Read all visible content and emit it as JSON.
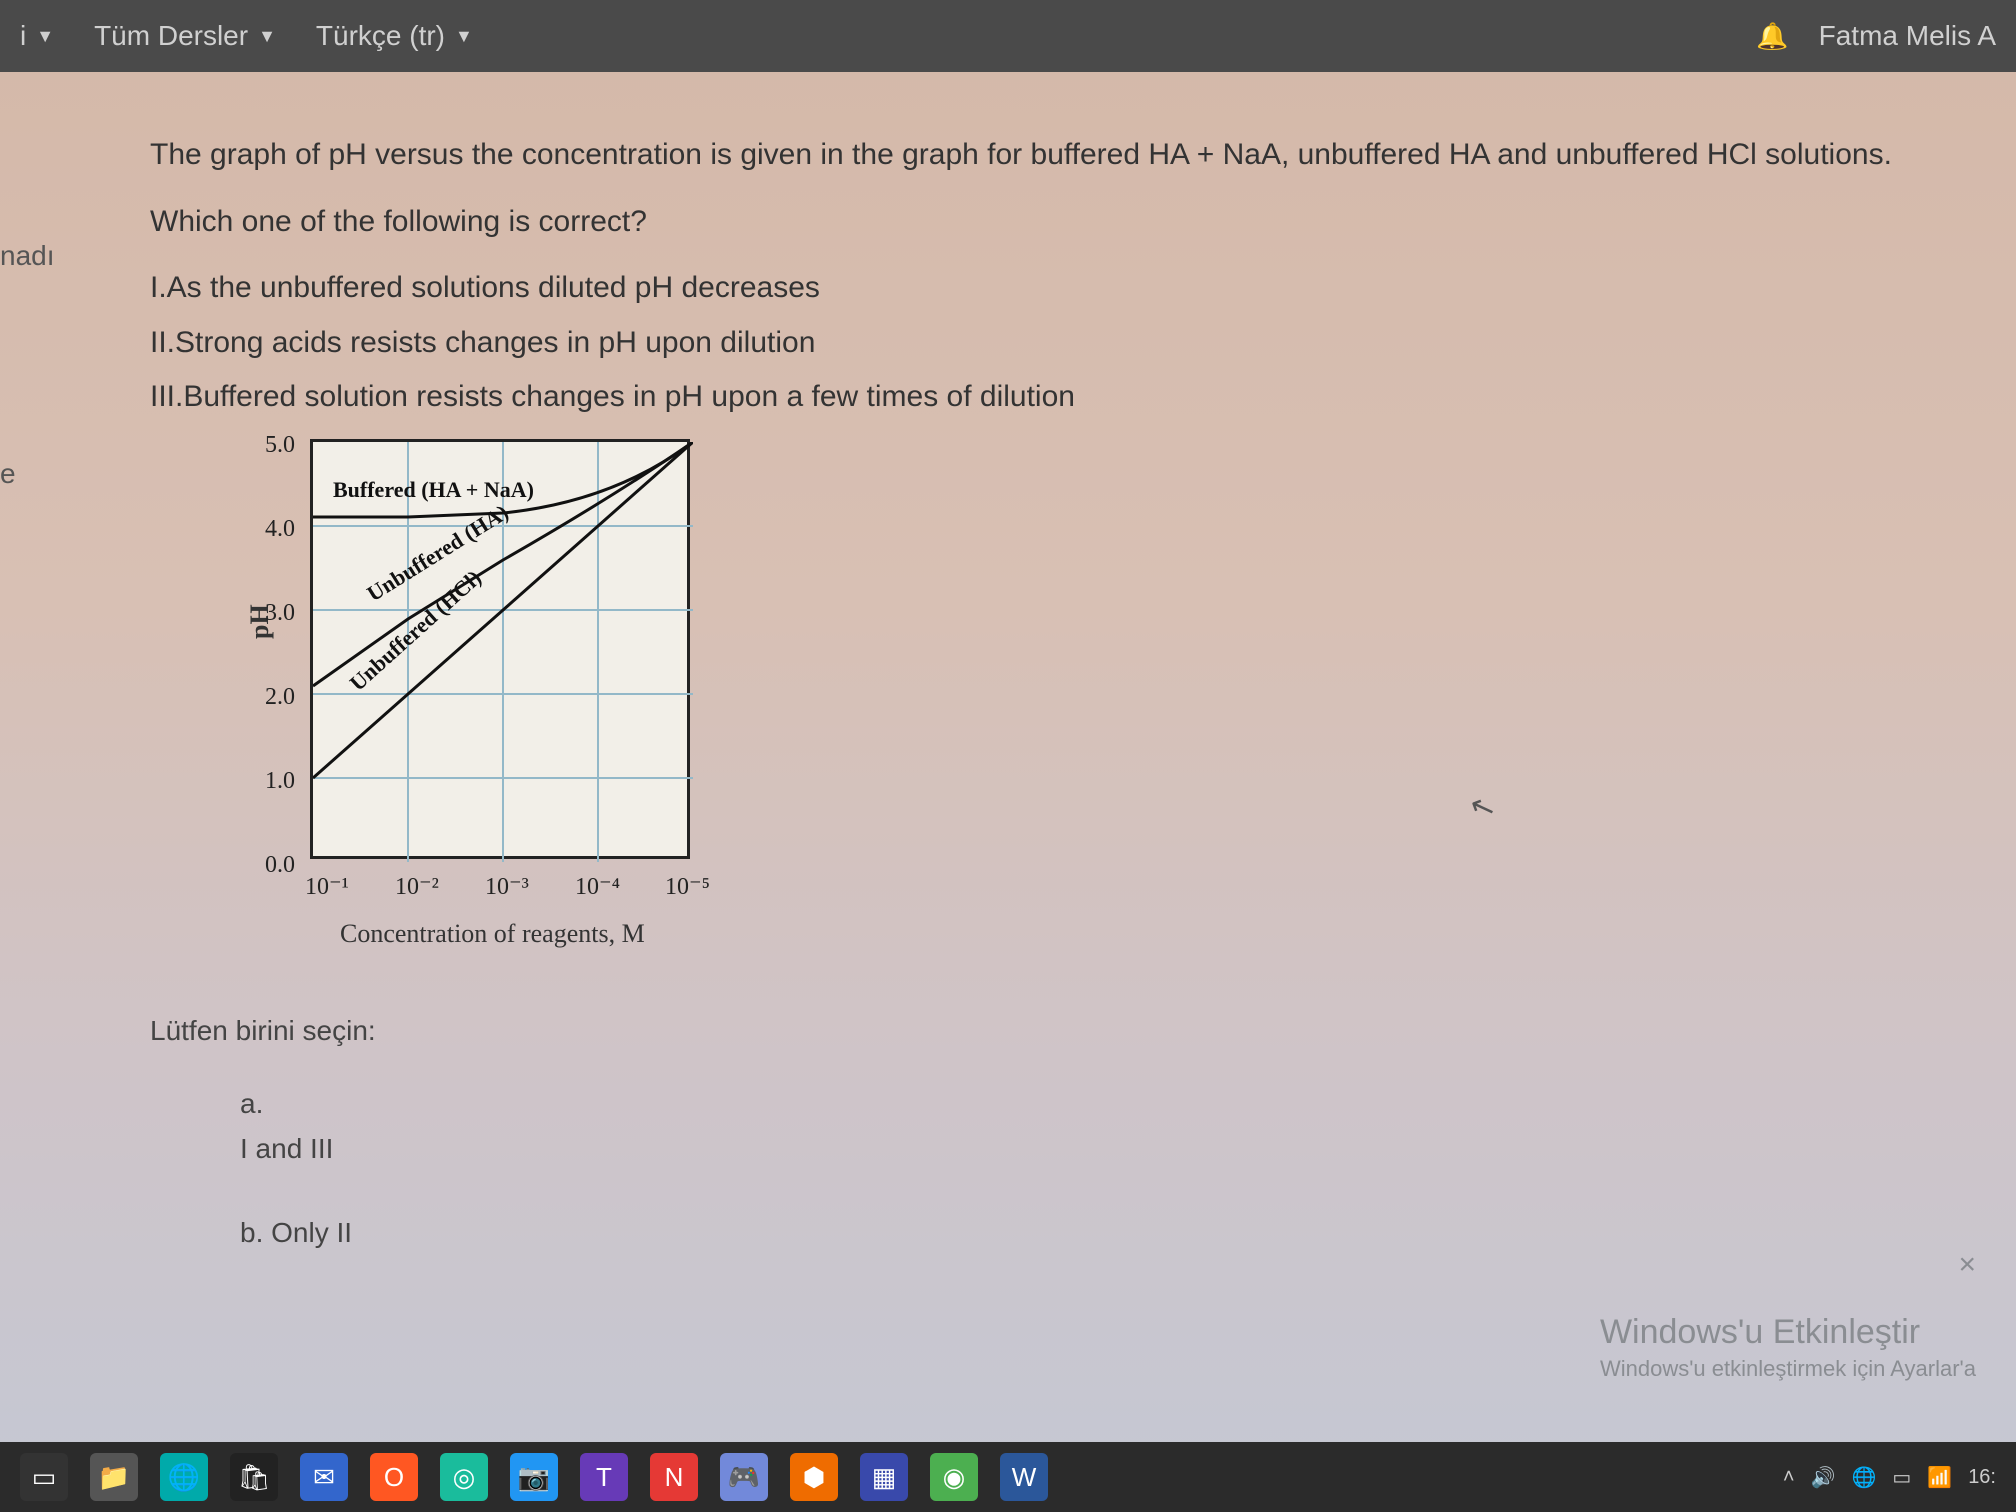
{
  "topbar": {
    "item1": "i",
    "item2": "Tüm Dersler",
    "item3": "Türkçe (tr)",
    "username": "Fatma Melis A"
  },
  "side": {
    "label1": "nadı",
    "label2": "e"
  },
  "question": {
    "intro": "The graph of pH versus the concentration is given in the graph for buffered  HA + NaA, unbuffered HA and unbuffered HCl solutions.",
    "prompt": "Which one of the following is correct?",
    "statement1": "I.As the unbuffered solutions diluted pH decreases",
    "statement2": "II.Strong acids resists changes in pH upon dilution",
    "statement3": "III.Buffered solution resists changes in pH upon a few times of dilution"
  },
  "chart_data": {
    "type": "line",
    "title": "",
    "xlabel": "Concentration of reagents, M",
    "ylabel": "pH",
    "x_categories": [
      "10⁻¹",
      "10⁻²",
      "10⁻³",
      "10⁻⁴",
      "10⁻⁵"
    ],
    "y_ticks": [
      "0.0",
      "1.0",
      "2.0",
      "3.0",
      "4.0",
      "5.0"
    ],
    "ylim": [
      0,
      5
    ],
    "series": [
      {
        "name": "Buffered (HA + NaA)",
        "values": [
          4.1,
          4.1,
          4.15,
          4.3,
          5.0
        ]
      },
      {
        "name": "Unbuffered (HA)",
        "values": [
          2.1,
          2.9,
          3.6,
          4.3,
          5.0
        ]
      },
      {
        "name": "Unbuffered (HCl)",
        "values": [
          1.0,
          2.0,
          3.0,
          4.0,
          5.0
        ]
      }
    ]
  },
  "choices": {
    "label": "Lütfen birini seçin:",
    "a_letter": "a.",
    "a_text": "I and III",
    "b_letter": "b. Only II"
  },
  "watermark": {
    "line1": "Windows'u Etkinleştir",
    "line2": "Windows'u etkinleştirmek için Ayarlar'a"
  },
  "tray": {
    "time": "16:"
  }
}
